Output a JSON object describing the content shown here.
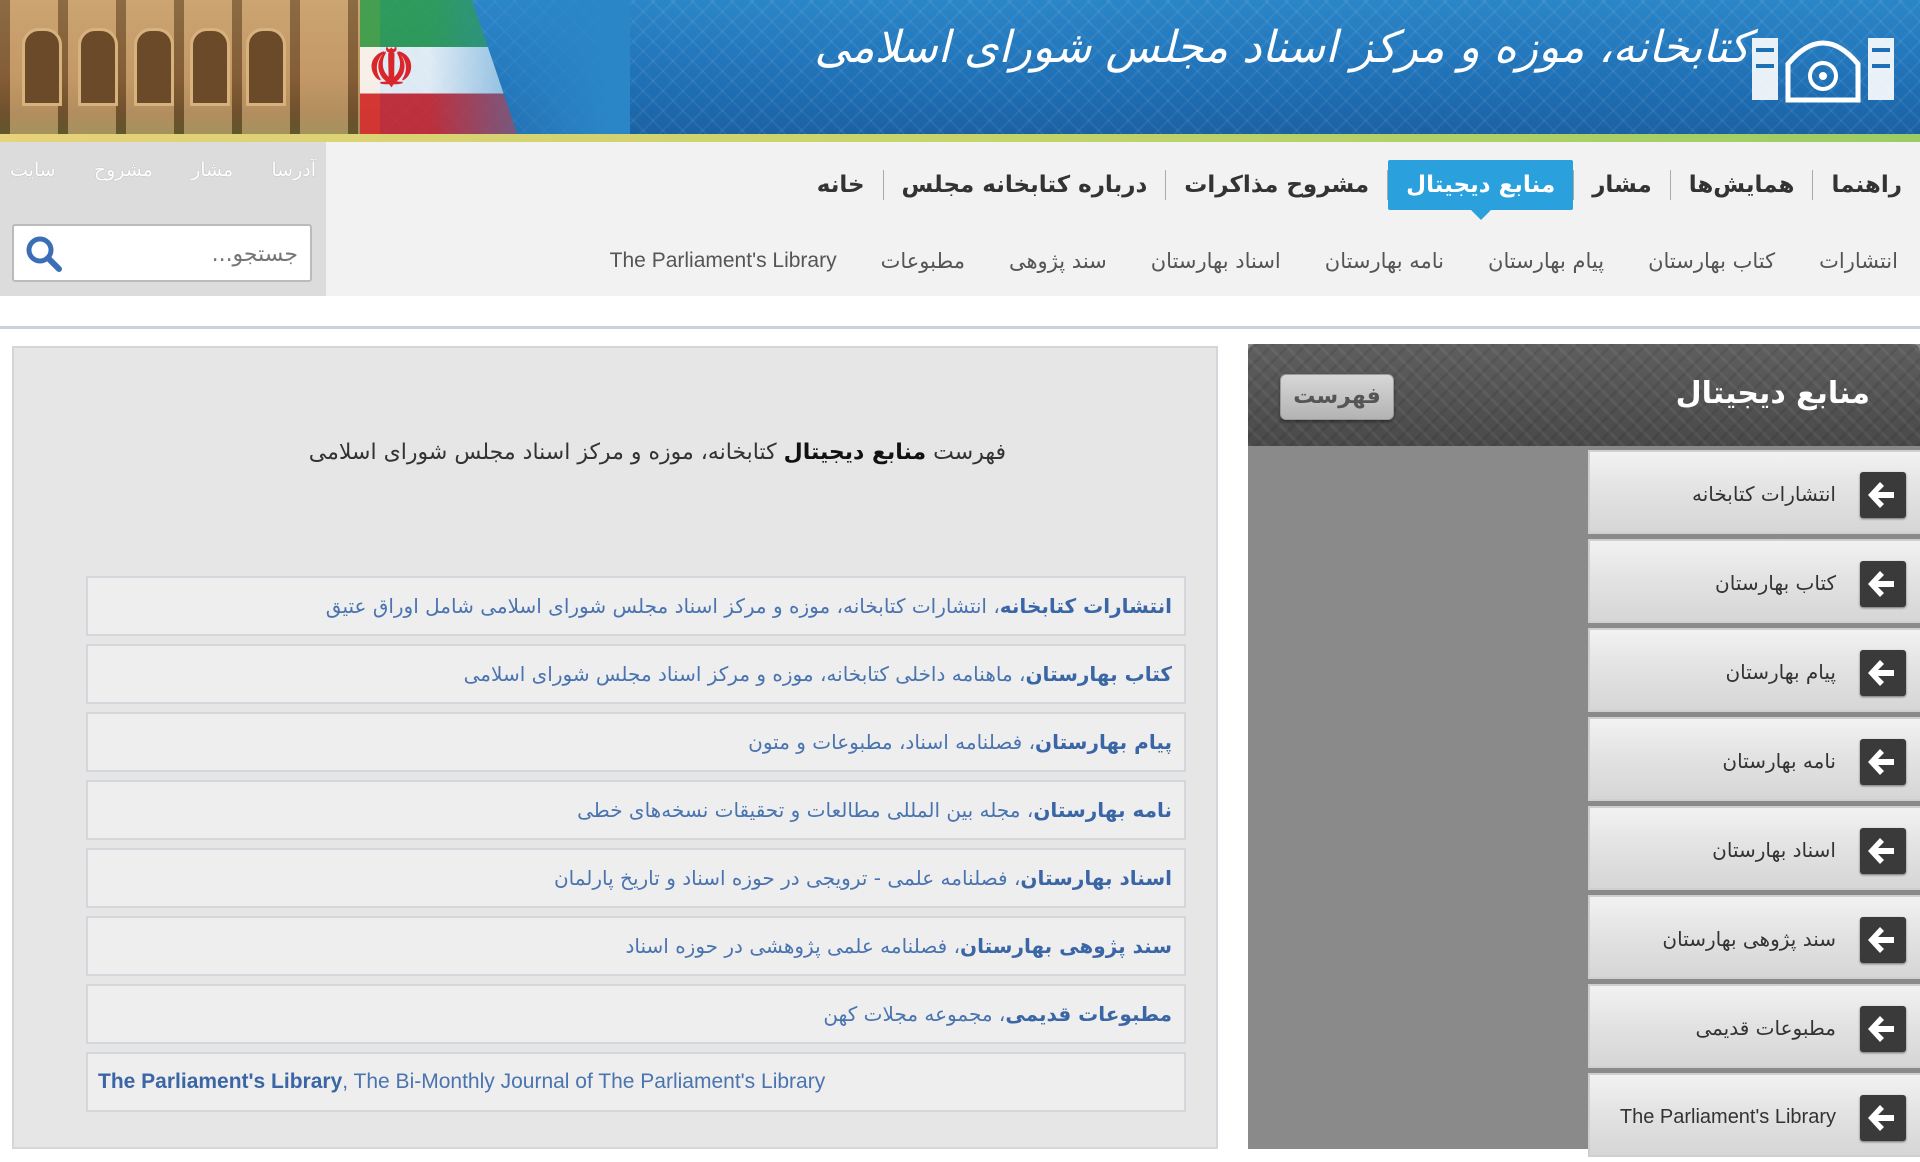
{
  "banner": {
    "logo_text": "کتابخانه، موزه و مرکز اسناد مجلس شورای اسلامی"
  },
  "quick_links": [
    "آدرسا",
    "مشار",
    "مشروح",
    "سایت"
  ],
  "search": {
    "placeholder": "جستجو..."
  },
  "main_nav": [
    {
      "label": "خانه",
      "active": false
    },
    {
      "label": "درباره کتابخانه مجلس",
      "active": false
    },
    {
      "label": "مشروح مذاکرات",
      "active": false
    },
    {
      "label": "منابع دیجیتال",
      "active": true
    },
    {
      "label": "مشار",
      "active": false
    },
    {
      "label": "همایش‌ها",
      "active": false
    },
    {
      "label": "راهنما",
      "active": false
    }
  ],
  "sub_nav": [
    "انتشارات",
    "کتاب بهارستان",
    "پیام بهارستان",
    "نامه بهارستان",
    "اسناد بهارستان",
    "سند پژوهی",
    "مطبوعات",
    "The Parliament's Library"
  ],
  "content": {
    "intro_prefix": "فهرست",
    "intro_bold": "منابع دیجیتال",
    "intro_suffix": "کتابخانه، موزه و مرکز اسناد مجلس شورای اسلامی",
    "resources": [
      {
        "title": "انتشارات کتابخانه",
        "desc": "، انتشارات کتابخانه، موزه و مرکز اسناد مجلس شورای اسلامی شامل اوراق عتیق"
      },
      {
        "title": "کتاب بهارستان",
        "desc": "، ماهنامه داخلی کتابخانه، موزه و مرکز اسناد مجلس شورای اسلامی"
      },
      {
        "title": "پیام بهارستان",
        "desc": "، فصلنامه اسناد، مطبوعات و متون"
      },
      {
        "title": "نامه بهارستان",
        "desc": "، مجله بین المللی مطالعات و تحقیقات نسخه‌های خطی"
      },
      {
        "title": "اسناد بهارستان",
        "desc": "، فصلنامه علمی - ترویجی در حوزه اسناد و تاریخ پارلمان"
      },
      {
        "title": "سند پژوهی بهارستان",
        "desc": "، فصلنامه علمی پژوهشی در حوزه اسناد"
      },
      {
        "title": "مطبوعات قدیمی",
        "desc": "، مجموعه مجلات کهن"
      },
      {
        "title": "The Parliament's Library",
        "desc": ", The Bi-Monthly Journal of The Parliament's Library"
      }
    ]
  },
  "sidebar": {
    "title": "منابع دیجیتال",
    "menu_button": "فهرست",
    "items": [
      "انتشارات کتابخانه",
      "کتاب بهارستان",
      "پیام بهارستان",
      "نامه بهارستان",
      "اسناد بهارستان",
      "سند پژوهی بهارستان",
      "مطبوعات قدیمی",
      "The Parliament's Library"
    ]
  },
  "colors": {
    "accent": "#2aa0dc",
    "link": "#4a74b0",
    "banner": "#1f6fb5"
  }
}
